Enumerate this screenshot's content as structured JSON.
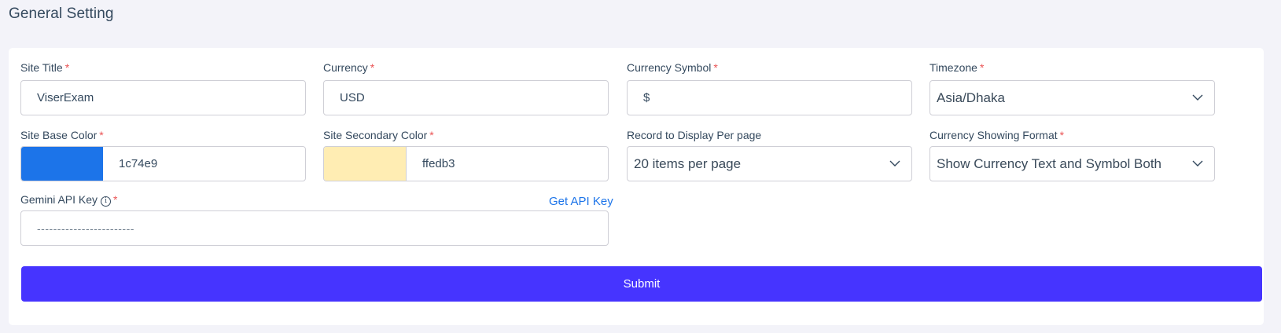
{
  "page": {
    "title": "General Setting"
  },
  "form": {
    "site_title": {
      "label": "Site Title",
      "required_mark": "*",
      "value": "ViserExam"
    },
    "currency": {
      "label": "Currency",
      "required_mark": "*",
      "value": "USD"
    },
    "currency_symbol": {
      "label": "Currency Symbol",
      "required_mark": "*",
      "value": "$"
    },
    "timezone": {
      "label": "Timezone",
      "required_mark": "*",
      "value": "Asia/Dhaka"
    },
    "base_color": {
      "label": "Site Base Color",
      "required_mark": "*",
      "value": "1c74e9",
      "swatch": "#1c74e9"
    },
    "secondary_color": {
      "label": "Site Secondary Color",
      "required_mark": "*",
      "value": "ffedb3",
      "swatch": "#ffedb3"
    },
    "records_per_page": {
      "label": "Record to Display Per page",
      "value": "20 items per page"
    },
    "currency_format": {
      "label": "Currency Showing Format",
      "required_mark": "*",
      "value": "Show Currency Text and Symbol Both"
    },
    "gemini_api_key": {
      "label": "Gemini API Key",
      "info_icon": "i",
      "required_mark": "*",
      "value": "------------------------",
      "link": "Get API Key"
    },
    "submit_label": "Submit"
  },
  "colors": {
    "accent": "#4634ff",
    "required": "#ea5455",
    "link": "#1c74e9"
  },
  "icons": {
    "select_arrow": "chevron-down-icon",
    "info": "info-circle-icon"
  }
}
